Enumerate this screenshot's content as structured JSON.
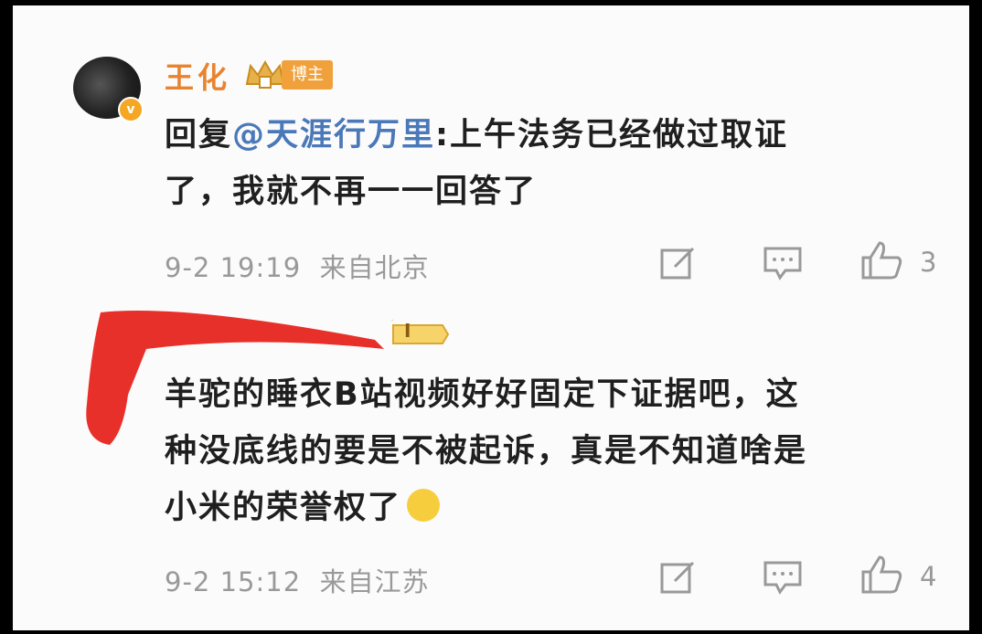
{
  "comment1": {
    "username": "王化",
    "author_badge": "博主",
    "text_line1_prefix": "回复",
    "mention": "@天涯行万里",
    "text_line1_rest": ":上午法务已经做过取证",
    "text_line2": "了，我就不再一一回答了",
    "timestamp": "9-2 19:19",
    "location": "来自北京",
    "like_count": "3"
  },
  "comment2": {
    "level_badge": "I",
    "text_line1": "羊驼的睡衣B站视频好好固定下证据吧，这",
    "text_line2": "种没底线的要是不被起诉，真是不知道啥是",
    "text_line3": "小米的荣誉权了",
    "timestamp": "9-2 15:12",
    "location": "来自江苏",
    "like_count": "4"
  },
  "colors": {
    "username": "#e8832f",
    "mention": "#4a78b8",
    "meta": "#999999",
    "redaction": "#e8302a"
  },
  "icons": [
    "verified-v-icon",
    "crown-icon",
    "edit-icon",
    "comment-icon",
    "like-icon",
    "laugh-cry-emoji-icon"
  ]
}
